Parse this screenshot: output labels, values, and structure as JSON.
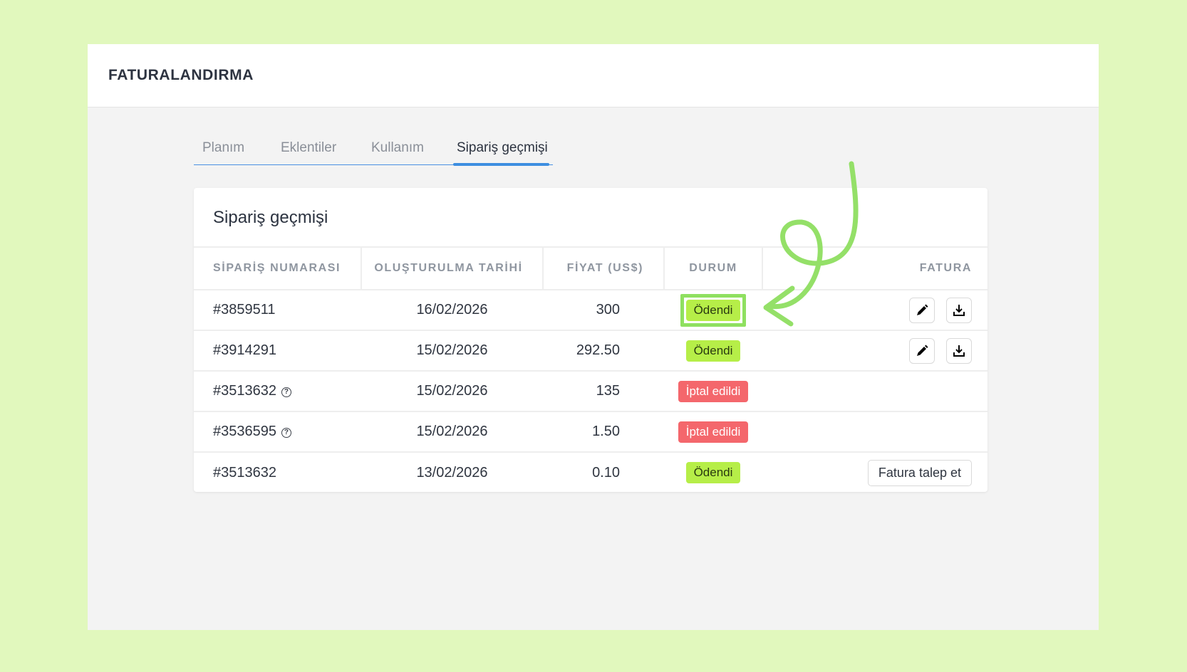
{
  "app": {
    "title": "FATURALANDIRMA"
  },
  "tabs": [
    {
      "label": "Planım",
      "active": false
    },
    {
      "label": "Eklentiler",
      "active": false
    },
    {
      "label": "Kullanım",
      "active": false
    },
    {
      "label": "Sipariş geçmişi",
      "active": true
    }
  ],
  "card": {
    "title": "Sipariş geçmişi"
  },
  "table": {
    "headers": {
      "order_no": "SİPARİŞ NUMARASI",
      "created": "OLUŞTURULMA TARİHİ",
      "price": "FİYAT (US$)",
      "status": "DURUM",
      "invoice": "FATURA"
    },
    "rows": [
      {
        "order_no": "#3859511",
        "date": "16/02/2026",
        "price": "300",
        "status": "Ödendi",
        "status_type": "paid"
      },
      {
        "order_no": "#3914291",
        "date": "15/02/2026",
        "price": "292.50",
        "status": "Ödendi",
        "status_type": "paid"
      },
      {
        "order_no": "#3513632",
        "date": "15/02/2026",
        "price": "135",
        "status": "İptal edildi",
        "status_type": "cancelled",
        "help": "?"
      },
      {
        "order_no": "#3536595",
        "date": "15/02/2026",
        "price": "1.50",
        "status": "İptal edildi",
        "status_type": "cancelled",
        "help": "?"
      },
      {
        "order_no": "#3513632",
        "date": "13/02/2026",
        "price": "0.10",
        "status": "Ödendi",
        "status_type": "paid"
      }
    ],
    "request_invoice_label": "Fatura talep et"
  },
  "icons": {
    "edit": "pencil-icon",
    "download": "download-icon",
    "help": "question-circle-icon"
  },
  "colors": {
    "paid_badge": "#b6ee48",
    "cancel_badge": "#f4676c",
    "accent": "#3d8ee0",
    "highlight": "#8fe060"
  }
}
